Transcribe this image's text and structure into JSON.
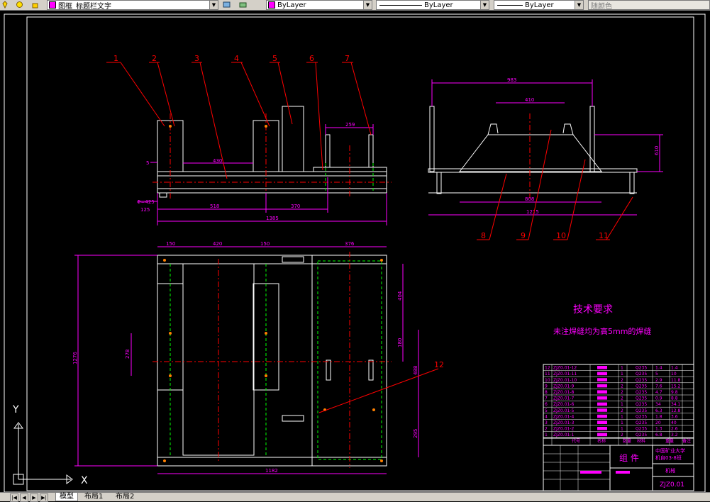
{
  "toolbar": {
    "text_style": "图框_标题栏文字",
    "color": "ByLayer",
    "linetype": "ByLayer",
    "lineweight": "ByLayer",
    "plot_style": "随颜色"
  },
  "drawing": {
    "balloons": [
      "1",
      "2",
      "3",
      "4",
      "5",
      "6",
      "7",
      "8",
      "9",
      "10",
      "11",
      "12"
    ],
    "front_dims": [
      "5",
      "430",
      "259",
      "Φ=425",
      "125",
      "518",
      "370",
      "1385"
    ],
    "side_dims": [
      "983",
      "410",
      "610",
      "808",
      "1215"
    ],
    "plan_dims": [
      "150",
      "420",
      "150",
      "376",
      "1276",
      "278",
      "404",
      "180",
      "488",
      "295",
      "1182"
    ],
    "tech_title": "技术要求",
    "tech_note": "未注焊缝均为高5mm的焊缝",
    "ucs": {
      "y": "Y",
      "x": "X"
    }
  },
  "title_block": {
    "parts": [
      {
        "no": "12",
        "code": "ZJZ0.01-12",
        "qty": "1",
        "mat": "Q235",
        "w1": "1.4",
        "w2": "1.4"
      },
      {
        "no": "11",
        "code": "ZJZ0.01-11",
        "qty": "1",
        "mat": "Q235",
        "w1": "5",
        "w2": "10"
      },
      {
        "no": "10",
        "code": "ZJZ0.01-10",
        "qty": "2",
        "mat": "Q235",
        "w1": "2.9",
        "w2": "11.8"
      },
      {
        "no": "9",
        "code": "ZJZ0.01-9",
        "qty": "2",
        "mat": "Q235",
        "w1": "7.6",
        "w2": "15.2"
      },
      {
        "no": "8",
        "code": "ZJZ0.01-8",
        "qty": "2",
        "mat": "Q235",
        "w1": "4.7",
        "w2": "9.8"
      },
      {
        "no": "7",
        "code": "ZJZ0.01-7",
        "qty": "2",
        "mat": "Q235",
        "w1": "0.9",
        "w2": "8.8"
      },
      {
        "no": "6",
        "code": "ZJZ0.01-6",
        "qty": "1",
        "mat": "Q235",
        "w1": "34",
        "w2": "34.1"
      },
      {
        "no": "5",
        "code": "ZJZ0.01-5",
        "qty": "2",
        "mat": "Q235",
        "w1": "6.3",
        "w2": "12.8"
      },
      {
        "no": "4",
        "code": "ZJZ0.01-4",
        "qty": "1",
        "mat": "Q235",
        "w1": "1.8",
        "w2": "3.6"
      },
      {
        "no": "3",
        "code": "ZJZ0.01-3",
        "qty": "1",
        "mat": "Q235",
        "w1": "20",
        "w2": "40"
      },
      {
        "no": "2",
        "code": "ZJZ0.01-2",
        "qty": "1",
        "mat": "Q235",
        "w1": "1.3",
        "w2": "2.6"
      },
      {
        "no": "1",
        "code": "ZJZ0.01-1",
        "qty": "2",
        "mat": "Q235",
        "w1": "6.8",
        "w2": "3.2"
      }
    ],
    "header": {
      "code": "代号",
      "name": "名称",
      "qty": "数量",
      "mat": "材料",
      "weight": "重量",
      "note": "备注"
    },
    "assembly": "组 件",
    "school": "中国矿业大学",
    "class": "机自03-8班",
    "dept": "机械",
    "drawing_no": "ZJZ0.01"
  },
  "tabs": {
    "model": "模型",
    "layout1": "布局1",
    "layout2": "布局2"
  },
  "colors": {
    "red": "#ff0000",
    "magenta": "#ff00ff",
    "white": "#ffffff",
    "green": "#00ff00",
    "toolbar": "#d4d0c8"
  }
}
